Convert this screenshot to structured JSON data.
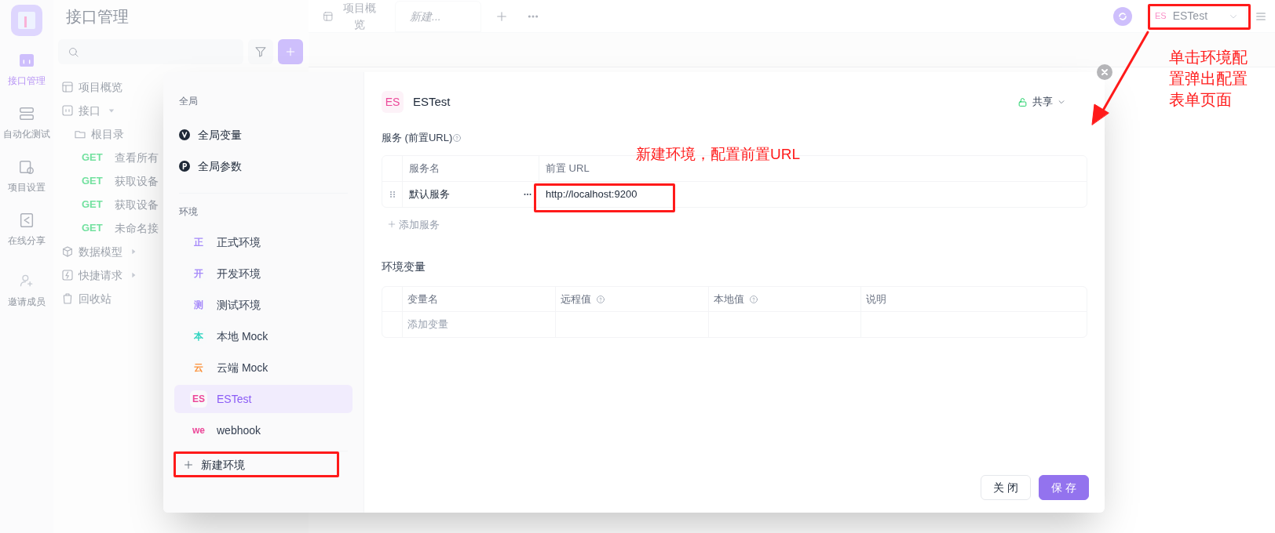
{
  "rail": {
    "items": [
      {
        "label": "接口管理",
        "kind": "api",
        "selected": true
      },
      {
        "label": "自动化测试",
        "kind": "auto",
        "selected": false
      },
      {
        "label": "项目设置",
        "kind": "settings",
        "selected": false
      },
      {
        "label": "在线分享",
        "kind": "share",
        "selected": false
      }
    ],
    "invite": "邀请成员"
  },
  "sidebar": {
    "title": "接口管理",
    "tree": [
      {
        "label": "项目概览",
        "kind": "overview"
      },
      {
        "label": "接口",
        "kind": "api",
        "expanded": true,
        "children": [
          {
            "label": "根目录",
            "kind": "dir",
            "children": [
              {
                "kind": "request",
                "method": "GET",
                "label": "查看所有"
              },
              {
                "kind": "request",
                "method": "GET",
                "label": "获取设备"
              },
              {
                "kind": "request",
                "method": "GET",
                "label": "获取设备"
              },
              {
                "kind": "request",
                "method": "GET",
                "label": "未命名接"
              }
            ]
          }
        ]
      },
      {
        "label": "数据模型",
        "kind": "model",
        "expanded": false
      },
      {
        "label": "快捷请求",
        "kind": "quick",
        "expanded": false
      },
      {
        "label": "回收站",
        "kind": "trash"
      }
    ]
  },
  "tabs": [
    {
      "label": "项目概览",
      "kind": "overview",
      "selected": false
    },
    {
      "label": "新建...",
      "kind": "draft",
      "selected": true
    }
  ],
  "env_selector": {
    "badge": "ES",
    "label": "ESTest"
  },
  "modal": {
    "global_heading": "全局",
    "global_items": [
      {
        "label": "全局变量",
        "kind": "variables"
      },
      {
        "label": "全局参数",
        "kind": "params"
      }
    ],
    "env_heading": "环境",
    "environments": [
      {
        "badge": "正",
        "label": "正式环境",
        "color": "#a78bfa",
        "selected": false
      },
      {
        "badge": "开",
        "label": "开发环境",
        "color": "#a78bfa",
        "selected": false
      },
      {
        "badge": "测",
        "label": "测试环境",
        "color": "#a78bfa",
        "selected": false
      },
      {
        "badge": "本",
        "label": "本地 Mock",
        "color": "#2dd4bf",
        "selected": false
      },
      {
        "badge": "云",
        "label": "云端 Mock",
        "color": "#fb923c",
        "selected": false
      },
      {
        "badge": "ES",
        "label": "ESTest",
        "color": "#ec4899",
        "selected": true
      },
      {
        "badge": "we",
        "label": "webhook",
        "color": "#ec4899",
        "selected": false
      }
    ],
    "new_env": "新建环境",
    "env": {
      "badge": "ES",
      "name": "ESTest",
      "color": "#ec4899"
    },
    "share": "共享",
    "services": {
      "title": "服务 (前置URL)",
      "columns": [
        "服务名",
        "前置 URL"
      ],
      "rows": [
        {
          "name": "默认服务",
          "url": "http://localhost:9200"
        }
      ],
      "add": "添加服务"
    },
    "variables": {
      "title": "环境变量",
      "columns": [
        {
          "label": "变量名",
          "help": false
        },
        {
          "label": "远程值",
          "help": true
        },
        {
          "label": "本地值",
          "help": true
        },
        {
          "label": "说明",
          "help": false
        }
      ],
      "placeholder": "添加变量"
    },
    "buttons": [
      {
        "label": "关 闭",
        "kind": "secondary"
      },
      {
        "label": "保 存",
        "kind": "primary"
      }
    ]
  },
  "annotations": [
    {
      "kind": "env-selector",
      "text": "单击环境配置弹出配置表单页面"
    },
    {
      "kind": "url",
      "text": "新建环境，配置前置URL"
    },
    {
      "kind": "new-env"
    }
  ]
}
